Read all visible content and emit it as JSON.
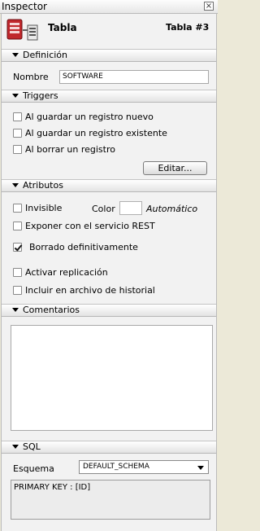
{
  "window": {
    "title": "Inspector"
  },
  "header": {
    "title": "Tabla",
    "table_number": "Tabla #3",
    "icon": "table-document-icon"
  },
  "sections": {
    "definicion": {
      "label": "Definición",
      "nombre_label": "Nombre",
      "nombre_value": "SOFTWARE"
    },
    "triggers": {
      "label": "Triggers",
      "items": [
        {
          "label": "Al guardar un registro nuevo",
          "checked": false
        },
        {
          "label": "Al guardar un registro existente",
          "checked": false
        },
        {
          "label": "Al borrar un registro",
          "checked": false
        }
      ],
      "edit_button": "Editar..."
    },
    "atributos": {
      "label": "Atributos",
      "invisible": "Invisible",
      "color_label": "Color",
      "color_value": "Automático",
      "rest": "Exponer con el servicio REST",
      "borrado": "Borrado definitivamente",
      "replicacion": "Activar replicación",
      "historial": "Incluir en archivo de historial"
    },
    "comentarios": {
      "label": "Comentarios",
      "text": ""
    },
    "sql": {
      "label": "SQL",
      "esquema_label": "Esquema",
      "esquema_value": "DEFAULT_SCHEMA",
      "statement": "PRIMARY KEY : [ID]"
    }
  }
}
